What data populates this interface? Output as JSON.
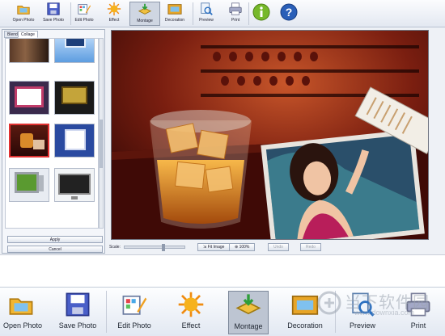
{
  "toolbar": {
    "buttons": [
      {
        "label": "Open Photo",
        "icon": "folder-photo-icon"
      },
      {
        "label": "Save Photo",
        "icon": "floppy-disk-icon"
      },
      {
        "label": "Edit Photo",
        "icon": "edit-photo-icon"
      },
      {
        "label": "Effect",
        "icon": "sun-burst-icon"
      },
      {
        "label": "Montage",
        "icon": "montage-icon",
        "active": true
      },
      {
        "label": "Decoration",
        "icon": "picture-frame-icon"
      },
      {
        "label": "Preview",
        "icon": "preview-icon"
      },
      {
        "label": "Print",
        "icon": "printer-icon"
      }
    ],
    "help_icons": [
      "info-icon",
      "help-icon"
    ]
  },
  "sidebar": {
    "tabs": [
      {
        "label": "Blend"
      },
      {
        "label": "Collage",
        "active": true
      }
    ],
    "apply_label": "Apply",
    "cancel_label": "Cancel"
  },
  "bottom_bar": {
    "scale_label": "Scale:",
    "fit_image_label": "Fit Image",
    "zoom_label": "100%",
    "undo_label": "Undo",
    "redo_label": "Redo"
  },
  "enlarged_toolbar": {
    "buttons": [
      {
        "label": "Open Photo"
      },
      {
        "label": "Save Photo"
      },
      {
        "label": "Edit Photo"
      },
      {
        "label": "Effect"
      },
      {
        "label": "Montage",
        "active": true
      },
      {
        "label": "Decoration"
      },
      {
        "label": "Preview"
      },
      {
        "label": "Print"
      }
    ]
  },
  "watermark": {
    "title": "当下软件园",
    "url": "www.downxia.com"
  },
  "colors": {
    "accent_active": "#bdc5d2",
    "selection": "#e03030",
    "canvas_bg": "#3a0d08"
  }
}
